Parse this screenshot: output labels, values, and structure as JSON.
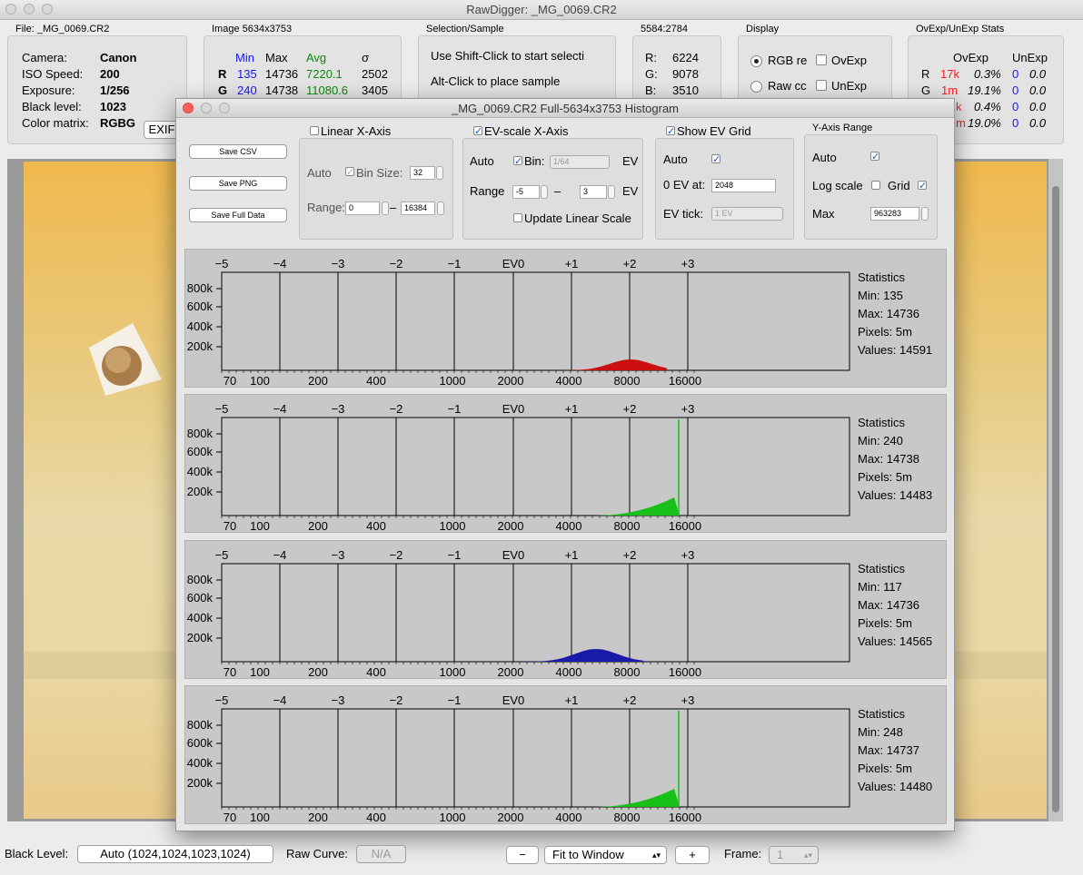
{
  "app": {
    "title": "RawDigger: _MG_0069.CR2"
  },
  "file_panel": {
    "label": "File: _MG_0069.CR2",
    "rows": [
      {
        "k": "Camera:",
        "v": "Canon"
      },
      {
        "k": "ISO Speed:",
        "v": "200"
      },
      {
        "k": "Exposure:",
        "v": "1/256"
      },
      {
        "k": "Black level:",
        "v": "1023"
      },
      {
        "k": "Color matrix:",
        "v": "RGBG"
      }
    ],
    "exif_button": "EXIF"
  },
  "image_panel": {
    "label": "Image 5634x3753",
    "headers": [
      "Min",
      "Max",
      "Avg",
      "σ"
    ],
    "rows": [
      {
        "ch": "R",
        "min": "135",
        "max": "14736",
        "avg": "7220.1",
        "sd": "2502"
      },
      {
        "ch": "G",
        "min": "240",
        "max": "14738",
        "avg": "11080.6",
        "sd": "3405"
      }
    ]
  },
  "selection_panel": {
    "label": "Selection/Sample",
    "line1": "Use Shift-Click to start selecti",
    "line2": "Alt-Click to place sample"
  },
  "coord_panel": {
    "label": "5584:2784",
    "rows": [
      {
        "k": "R:",
        "v": "6224"
      },
      {
        "k": "G:",
        "v": "9078"
      },
      {
        "k": "B:",
        "v": "3510"
      }
    ]
  },
  "display_panel": {
    "label": "Display",
    "rgb": "RGB re",
    "raw": "Raw cc",
    "ovexp": "OvExp",
    "unexp": "UnExp"
  },
  "stats_panel": {
    "label": "OvExp/UnExp Stats",
    "headers": [
      "OvExp",
      "UnExp"
    ],
    "rows": [
      {
        "ch": "R",
        "cnt": "17k",
        "pct": "0.3%",
        "un": "0",
        "unpct": "0.0"
      },
      {
        "ch": "G",
        "cnt": "1m",
        "pct": "19.1%",
        "un": "0",
        "unpct": "0.0"
      },
      {
        "ch": "",
        "cnt": "k",
        "pct": "0.4%",
        "un": "0",
        "unpct": "0.0"
      },
      {
        "ch": "",
        "cnt": "m",
        "pct": "19.0%",
        "un": "0",
        "unpct": "0.0"
      }
    ]
  },
  "dialog": {
    "title": "_MG_0069.CR2 Full-5634x3753 Histogram",
    "save_csv": "Save CSV",
    "save_png": "Save PNG",
    "save_full": "Save Full Data",
    "linear": {
      "title": "Linear X-Axis",
      "auto": "Auto",
      "bin_label": "Bin Size:",
      "bin_value": "32",
      "range_label": "Range:",
      "range_from": "0",
      "dash": "–",
      "range_to": "16384"
    },
    "ev": {
      "title": "EV-scale X-Axis",
      "auto": "Auto",
      "bin_label": "Bin:",
      "bin_value": "1/64",
      "ev": "EV",
      "range_label": "Range",
      "range_from": "-5",
      "dash": "–",
      "range_to": "3",
      "update": "Update Linear Scale"
    },
    "grid": {
      "title": "Show EV Grid",
      "auto": "Auto",
      "zero_label": "0 EV at:",
      "zero_value": "2048",
      "tick_label": "EV tick:",
      "tick_value": "1 EV"
    },
    "yaxis": {
      "title": "Y-Axis Range",
      "auto": "Auto",
      "log": "Log scale",
      "grid": "Grid",
      "max_label": "Max",
      "max_value": "963283"
    }
  },
  "histograms": {
    "ev_ticks": [
      "−5",
      "−4",
      "−3",
      "−2",
      "−1",
      "EV0",
      "+1",
      "+2",
      "+3"
    ],
    "x_ticks": [
      "70",
      "100",
      "200",
      "400",
      "1000",
      "2000",
      "4000",
      "8000",
      "16000"
    ],
    "y_ticks": [
      "800k",
      "600k",
      "400k",
      "200k"
    ],
    "stats_title": "Statistics",
    "panels": [
      {
        "color": "#cc1010",
        "min": "Min: 135",
        "max": "Max: 14736",
        "pixels": "Pixels: 5m",
        "values": "Values: 14591"
      },
      {
        "color": "#19c019",
        "min": "Min: 240",
        "max": "Max: 14738",
        "pixels": "Pixels: 5m",
        "values": "Values: 14483"
      },
      {
        "color": "#1a1aaa",
        "min": "Min: 117",
        "max": "Max: 14736",
        "pixels": "Pixels: 5m",
        "values": "Values: 14565"
      },
      {
        "color": "#19c019",
        "min": "Min: 248",
        "max": "Max: 14737",
        "pixels": "Pixels: 5m",
        "values": "Values: 14480"
      }
    ]
  },
  "bottom": {
    "black_label": "Black Level:",
    "black_value": "Auto (1024,1024,1023,1024)",
    "curve_label": "Raw Curve:",
    "curve_value": "N/A",
    "minus": "−",
    "fit": "Fit to Window",
    "plus": "+",
    "frame_label": "Frame:",
    "frame_value": "1"
  }
}
